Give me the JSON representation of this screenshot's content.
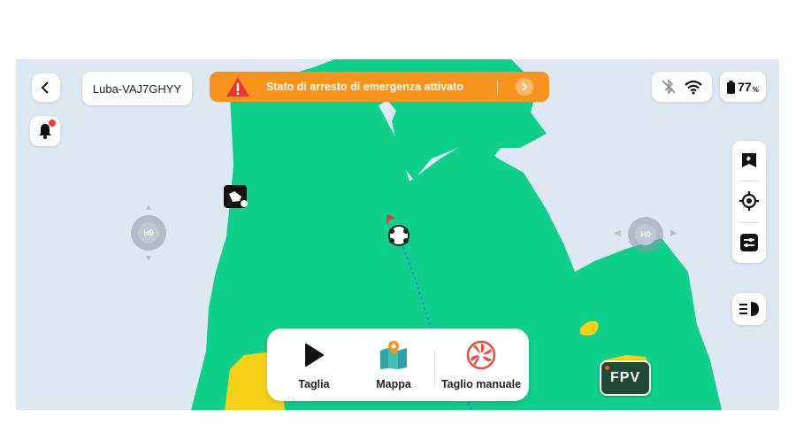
{
  "device": {
    "name": "Luba-VAJ7GHYY"
  },
  "alert": {
    "text": "Stato di arresto di emergenza attivato",
    "color": "#f7941d"
  },
  "status": {
    "battery": "77",
    "battery_unit": "%"
  },
  "joysticks": {
    "left_label": "H9",
    "right_label": "H9"
  },
  "bottom_bar": {
    "items": [
      {
        "label": "Taglia",
        "icon": "play-icon"
      },
      {
        "label": "Mappa",
        "icon": "map-icon"
      },
      {
        "label": "Taglio manuale",
        "icon": "fan-blade-icon"
      }
    ]
  },
  "fpv": {
    "label": "FPV"
  },
  "colors": {
    "lawn": "#0fd08a",
    "sand": "#f7d117",
    "background": "#dde8f3",
    "path": "#2b7fd4"
  },
  "icons": [
    "back-icon",
    "bell-icon",
    "warning-icon",
    "chevron-right-icon",
    "bluetooth-off-icon",
    "wifi-icon",
    "battery-icon",
    "map-pin-icon",
    "locate-icon",
    "sliders-icon",
    "headlight-icon",
    "play-icon",
    "map-icon",
    "fan-blade-icon",
    "obstacle-icon",
    "mower-icon"
  ]
}
